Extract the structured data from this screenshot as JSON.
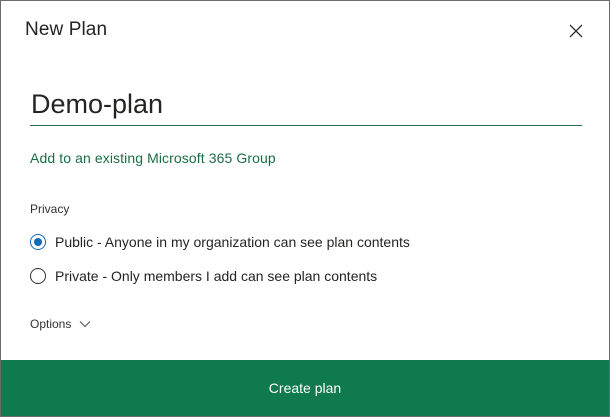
{
  "dialog": {
    "title": "New Plan",
    "close_icon": "close-icon"
  },
  "plan_name": {
    "value": "Demo-plan",
    "placeholder": ""
  },
  "group_link": {
    "label": "Add to an existing Microsoft 365 Group"
  },
  "privacy": {
    "heading": "Privacy",
    "options": [
      {
        "label": "Public - Anyone in my organization can see plan contents",
        "selected": true
      },
      {
        "label": "Private - Only members I add can see plan contents",
        "selected": false
      }
    ]
  },
  "options_toggle": {
    "label": "Options",
    "icon": "chevron-down-icon"
  },
  "footer": {
    "create_label": "Create plan"
  },
  "colors": {
    "accent_green": "#0e7a4d",
    "link_green": "#1a6e45",
    "radio_blue": "#0f6cbd"
  }
}
